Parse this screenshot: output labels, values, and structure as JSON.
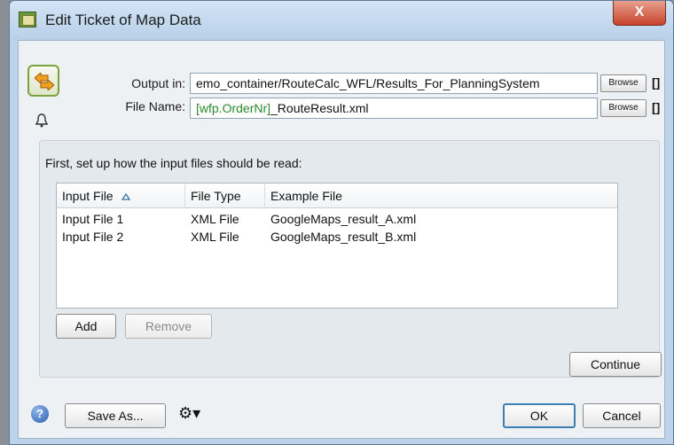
{
  "window": {
    "title": "Edit Ticket of Map Data",
    "close_label": "X"
  },
  "output": {
    "output_label": "Output in:",
    "output_value": "emo_container/RouteCalc_WFL/Results_For_PlanningSystem",
    "file_name_label": "File Name:",
    "file_name_var": "[wfp.OrderNr]",
    "file_name_rest": "_RouteResult.xml",
    "browse_label": "Browse",
    "brackets_label": "[]"
  },
  "input_panel": {
    "intro": "First, set up how the input files should be read:",
    "columns": [
      "Input File",
      "File Type",
      "Example File"
    ],
    "sort_indicator": "^",
    "rows": [
      [
        "Input File 1",
        "XML File",
        "GoogleMaps_result_A.xml"
      ],
      [
        "Input File 2",
        "XML File",
        "GoogleMaps_result_B.xml"
      ]
    ],
    "add_label": "Add",
    "remove_label": "Remove",
    "continue_label": "Continue"
  },
  "footer": {
    "help_label": "?",
    "save_as_label": "Save As...",
    "gear_label": "⚙▾",
    "ok_label": "OK",
    "cancel_label": "Cancel"
  },
  "colors": {
    "variable_text": "#2a8a2a",
    "accent_border": "#3c7fb1",
    "titlebar": "#c8dcf0"
  },
  "icons": [
    "app-icon",
    "close-icon",
    "swap-arrows-icon",
    "bell-icon",
    "sort-up-icon",
    "help-icon",
    "gear-icon"
  ]
}
